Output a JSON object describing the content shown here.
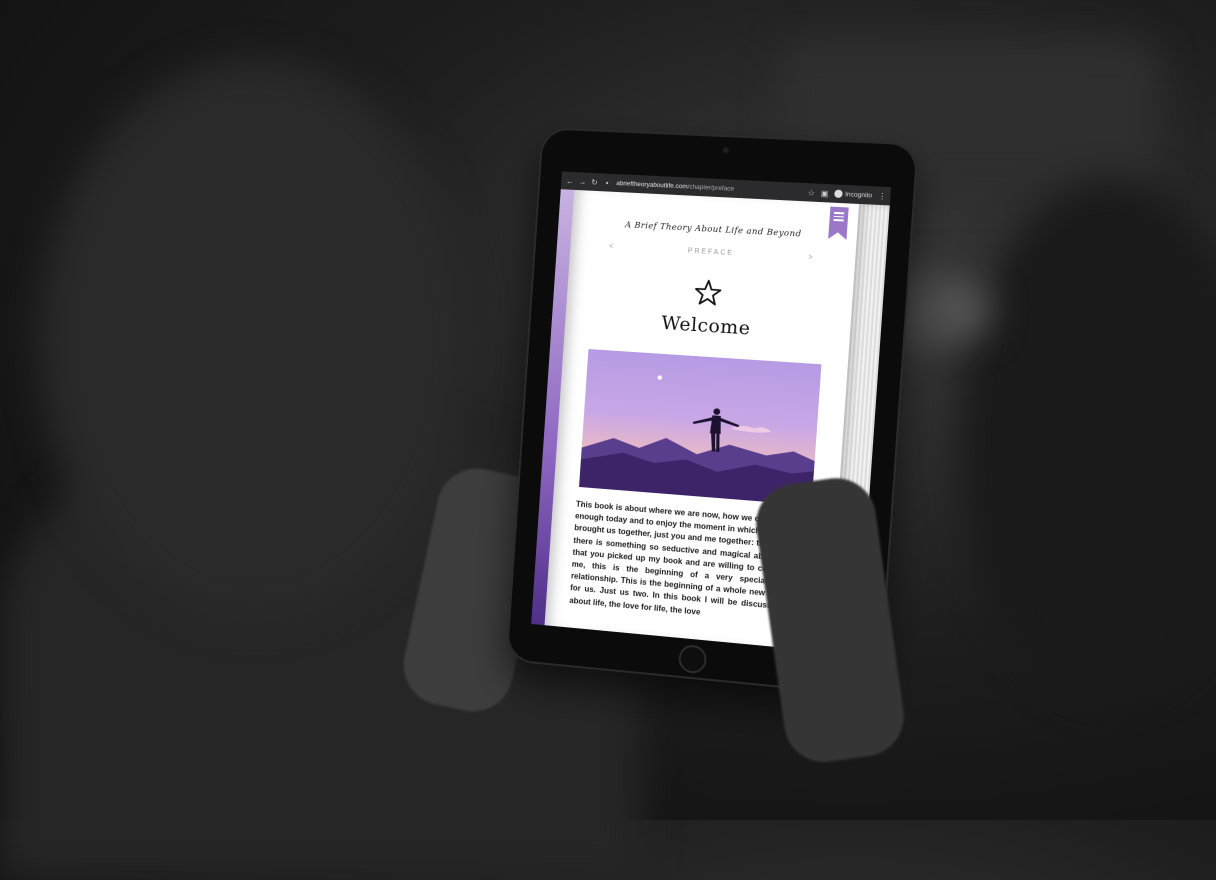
{
  "browser": {
    "url_domain": "abrieftheoryaboutlife.com",
    "url_path": "/chapter/preface",
    "mode_label": "Incognito"
  },
  "book": {
    "title": "A Brief Theory About Life and Beyond",
    "chapter_label": "PREFACE",
    "prev_symbol": "<",
    "next_symbol": ">",
    "heading": "Welcome",
    "body": "This book is about where we are now, how we can appreciate enough today and to enjoy the moment in which the universe brought us together, just you and me together: think about it, there is something so seductive and magical about the fact that you picked up my book and are willing to connect with me, this is the beginning of a very special, intimate relationship. This is the beginning of a whole new adventure for us. Just us two. In this book I will be discussing a lot about life, the love for life, the love"
  },
  "colors": {
    "accent": "#9a77c9",
    "spine": "#8e67c2"
  },
  "icons": {
    "menu": "hamburger-icon",
    "star": "star-icon"
  }
}
